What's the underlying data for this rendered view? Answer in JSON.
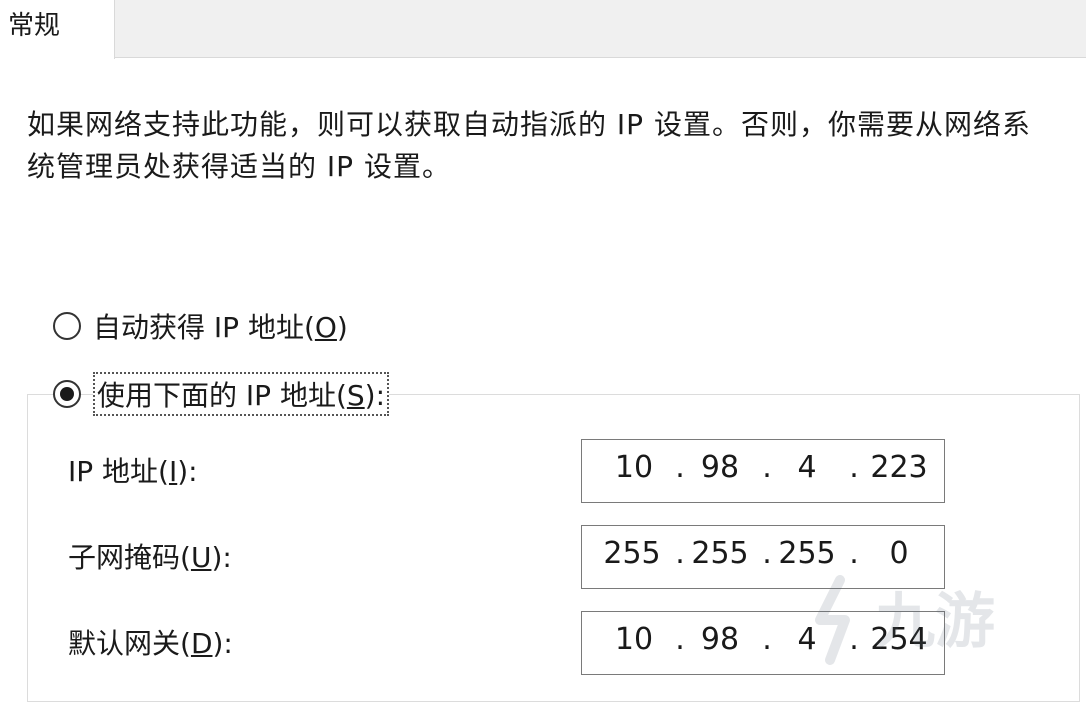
{
  "tab": {
    "label": "常规"
  },
  "description": "如果网络支持此功能，则可以获取自动指派的 IP 设置。否则，你需要从网络系统管理员处获得适当的 IP 设置。",
  "radio_auto": {
    "text_before": "自动获得 IP 地址(",
    "mnemonic": "O",
    "text_after": ")",
    "selected": false
  },
  "radio_manual": {
    "text_before": "使用下面的 IP 地址(",
    "mnemonic": "S",
    "text_after": "):",
    "selected": true
  },
  "fields": {
    "ip": {
      "label_before": "IP 地址(",
      "mnemonic": "I",
      "label_after": "):",
      "octets": [
        "10",
        "98",
        "4",
        "223"
      ]
    },
    "subnet": {
      "label_before": "子网掩码(",
      "mnemonic": "U",
      "label_after": "):",
      "octets": [
        "255",
        "255",
        "255",
        "0"
      ]
    },
    "gateway": {
      "label_before": "默认网关(",
      "mnemonic": "D",
      "label_after": "):",
      "octets": [
        "10",
        "98",
        "4",
        "254"
      ]
    }
  },
  "separator": ".",
  "watermark": {
    "text": "九游",
    "color": "#5b6b7a"
  }
}
